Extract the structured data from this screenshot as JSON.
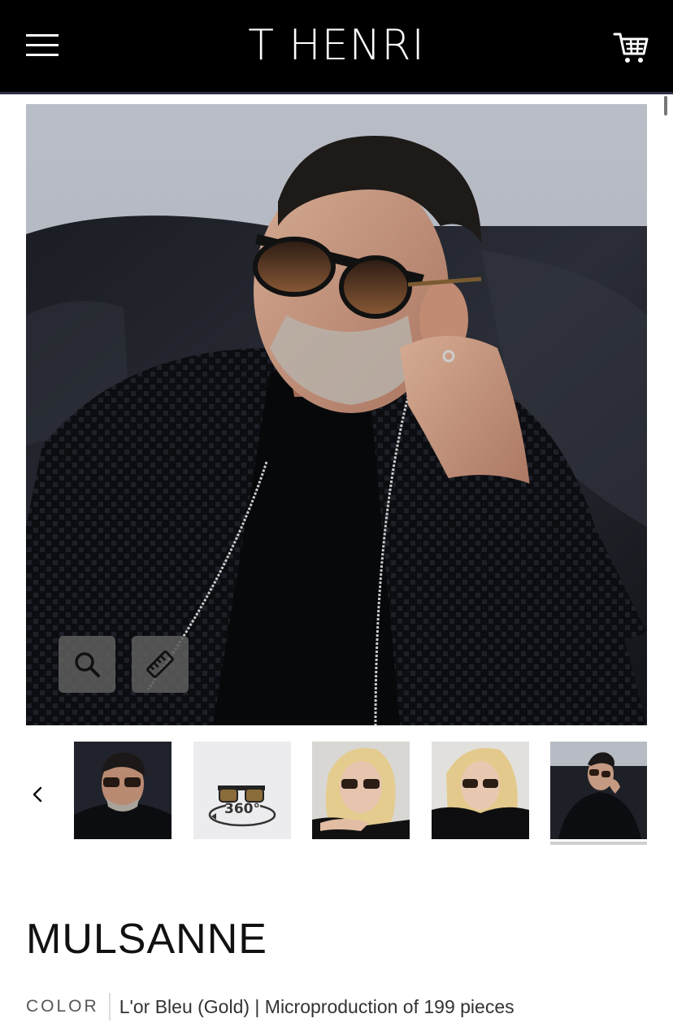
{
  "header": {
    "brand": "T HENRI",
    "menu_icon": "hamburger-menu-icon",
    "cart_icon": "shopping-cart-icon"
  },
  "gallery": {
    "main_image": "man in sunglasses and black leather jacket on leather sofa",
    "tools": [
      {
        "name": "zoom",
        "icon": "magnifier-icon"
      },
      {
        "name": "measure",
        "icon": "ruler-icon"
      }
    ],
    "thumbnails": [
      {
        "label": "",
        "active": false
      },
      {
        "label": "360°",
        "active": false
      },
      {
        "label": "",
        "active": false
      },
      {
        "label": "",
        "active": false
      },
      {
        "label": "",
        "active": true
      }
    ]
  },
  "product": {
    "name": "MULSANNE",
    "color_label": "COLOR",
    "color_value": "L'or Bleu (Gold) | Microproduction of 199 pieces"
  },
  "colors": {
    "header_bg": "#000000",
    "accent_line": "#2b2f45",
    "tool_button_bg": "#5c5c5c"
  }
}
